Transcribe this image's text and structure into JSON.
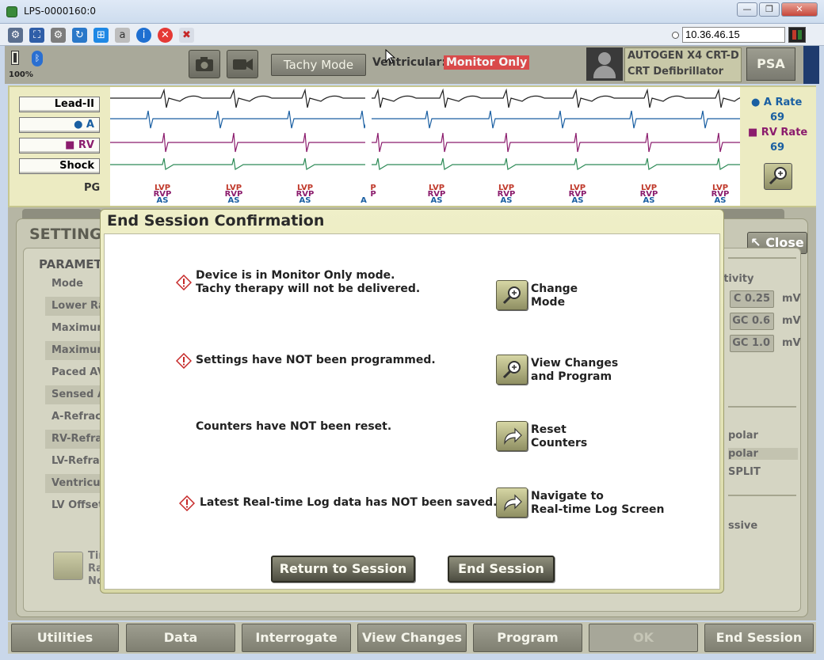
{
  "window": {
    "title": "LPS-0000160:0",
    "buttons": {
      "minimize": "—",
      "maximize": "❐",
      "close": "✕"
    }
  },
  "toolbar": {
    "icons": [
      "network-icon",
      "fullscreen-icon",
      "settings-gear-icon",
      "refresh-icon",
      "windows-icon",
      "keyboard-icon",
      "info-icon",
      "stop-icon",
      "disconnect-icon"
    ],
    "ip_address": "10.36.46.15"
  },
  "header": {
    "battery_percent": "100%",
    "tachy_mode_label": "Tachy Mode",
    "ventricular_label": "Ventricular:",
    "ventricular_value": "Monitor Only",
    "device_line1": "AUTOGEN X4 CRT-D",
    "device_line2": "CRT Defibrillator",
    "psa_label": "PSA"
  },
  "ecg": {
    "leads": [
      "Lead-II",
      "● A",
      "■ RV",
      "Shock"
    ],
    "pg_label": "PG",
    "a_rate_label": "● A Rate",
    "a_rate_value": "69",
    "rv_rate_label": "■ RV Rate",
    "rv_rate_value": "69",
    "markers": [
      {
        "lvp": "LVP",
        "rvp": "RVP",
        "as": "AS"
      },
      {
        "lvp": "LVP",
        "rvp": "RVP",
        "as": "AS"
      },
      {
        "lvp": "LVP",
        "rvp": "RVP",
        "as": "AS"
      },
      {
        "lvp": "",
        "rvp": "",
        "as": "A"
      },
      {
        "lvp": "P",
        "rvp": "P",
        "as": ""
      },
      {
        "lvp": "LVP",
        "rvp": "RVP",
        "as": "AS"
      },
      {
        "lvp": "LVP",
        "rvp": "RVP",
        "as": "AS"
      },
      {
        "lvp": "LVP",
        "rvp": "RVP",
        "as": "AS"
      },
      {
        "lvp": "LVP",
        "rvp": "RVP",
        "as": "AS"
      },
      {
        "lvp": "LVP",
        "rvp": "RVP",
        "as": "AS"
      }
    ]
  },
  "background": {
    "settings_title": "SETTINGS",
    "close_label": "Close",
    "parameters_title": "PARAMET",
    "param_rows": [
      "Mode",
      "Lower Rat",
      "Maximum",
      "Maximum",
      "Paced AV",
      "Sensed A",
      "A-Refract",
      "RV-Refrac",
      "LV-Refrac",
      "Ventricula",
      "LV Offset"
    ],
    "sensitivity_label": "sitivity",
    "sens_values": [
      "C 0.25",
      "GC 0.6",
      "GC 1.0"
    ],
    "sens_unit": "mV",
    "polarity": [
      "polar",
      "polar",
      "SPLIT"
    ],
    "ssive": "ssive",
    "zoom_texts": [
      "Tim",
      "Rat",
      "Nois"
    ]
  },
  "modal": {
    "title": "End Session Confirmation",
    "messages": [
      {
        "text": "Device is in Monitor Only mode.\nTachy therapy will not be delivered.",
        "warning": true,
        "action": "Change\nMode"
      },
      {
        "text": "Settings have NOT been programmed.",
        "warning": true,
        "action": "View Changes\nand Program"
      },
      {
        "text": "Counters have NOT been reset.",
        "warning": false,
        "action": "   Reset\nCounters"
      },
      {
        "text": "Latest Real-time Log data has NOT been saved.",
        "warning": true,
        "action": "Navigate to\nReal-time Log Screen"
      }
    ],
    "return_label": "Return to Session",
    "end_label": "End Session"
  },
  "bottom_bar": {
    "buttons": [
      "Utilities",
      "Data",
      "Interrogate",
      "View Changes",
      "Program",
      "OK",
      "End Session"
    ]
  },
  "colors": {
    "header_bg": "#a9a99a",
    "ecg_panel_bg": "#ecebc2",
    "modal_frame": "#e3e3b4",
    "alert_red": "#d94a4a",
    "lvp_red": "#c0392b",
    "rvp_purple": "#8b1c6d",
    "as_blue": "#1a5fa2"
  }
}
